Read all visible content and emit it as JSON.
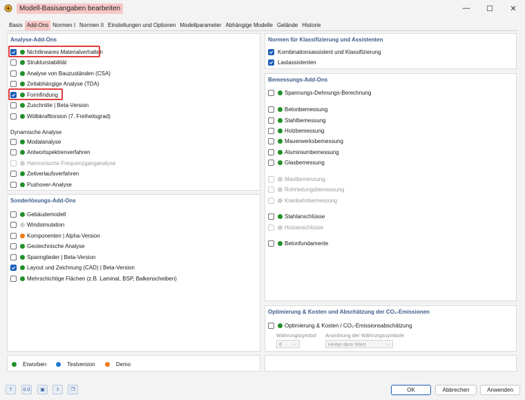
{
  "window": {
    "title": "Modell-Basisangaben bearbeiten"
  },
  "tabs": [
    "Basis",
    "Add-Ons",
    "Normen I",
    "Normen II",
    "Einstellungen und Optionen",
    "Modellparameter",
    "Abhängige Modelle",
    "Gelände",
    "Historie"
  ],
  "analysis": {
    "header": "Analyse-Add-Ons",
    "items": [
      {
        "label": "Nichtlineares Materialverhalten",
        "checked": true,
        "dot": "green"
      },
      {
        "label": "Strukturstabilität",
        "checked": false,
        "dot": "green"
      },
      {
        "label": "Analyse von Bauzuständen (CSA)",
        "checked": false,
        "dot": "green"
      },
      {
        "label": "Zeitabhängige Analyse (TDA)",
        "checked": false,
        "dot": "green"
      },
      {
        "label": "Formfindung",
        "checked": true,
        "dot": "green"
      },
      {
        "label": "Zuschnitte | Beta-Version",
        "checked": false,
        "dot": "green"
      },
      {
        "label": "Wölbkrafttorsion (7. Freiheitsgrad)",
        "checked": false,
        "dot": "green"
      }
    ],
    "dynamic_header": "Dynamische Analyse",
    "dynamic_items": [
      {
        "label": "Modalanalyse",
        "checked": false,
        "dot": "green"
      },
      {
        "label": "Antwortspektrenverfahren",
        "checked": false,
        "dot": "green"
      },
      {
        "label": "Harmonische Frequenzganganalyse",
        "checked": false,
        "dot": "grey",
        "disabled": true
      },
      {
        "label": "Zeitverlaufsverfahren",
        "checked": false,
        "dot": "green"
      },
      {
        "label": "Pushover-Analyse",
        "checked": false,
        "dot": "green"
      }
    ]
  },
  "special": {
    "header": "Sonderlösungs-Add-Ons",
    "items": [
      {
        "label": "Gebäudemodell",
        "checked": false,
        "dot": "green"
      },
      {
        "label": "Windsimulation",
        "checked": false,
        "dot": "grey"
      },
      {
        "label": "Komponenten | Alpha-Version",
        "checked": false,
        "dot": "orange"
      },
      {
        "label": "Geotechnische Analyse",
        "checked": false,
        "dot": "green"
      },
      {
        "label": "Spannglieder | Beta-Version",
        "checked": false,
        "dot": "green"
      },
      {
        "label": "Layout und Zeichnung (CAD) | Beta-Version",
        "checked": true,
        "dot": "green"
      },
      {
        "label": "Mehrschichtige Flächen (z.B. Laminat, BSP, Balkenscheiben)",
        "checked": false,
        "dot": "green"
      }
    ]
  },
  "legend": {
    "erworben": "Erworben",
    "testversion": "Testversion",
    "demo": "Demo"
  },
  "standards": {
    "header": "Normen für Klassifizierung und Assistenten",
    "items": [
      {
        "label": "Kombinationsassistent und Klassifizierung",
        "checked": true
      },
      {
        "label": "Lastassistenten",
        "checked": true
      }
    ]
  },
  "design": {
    "header": "Bemessungs-Add-Ons",
    "items": [
      {
        "label": "Spannungs-Dehnungs-Berechnung",
        "checked": false,
        "dot": "green"
      },
      {
        "label": "Betonbemessung",
        "checked": false,
        "dot": "green"
      },
      {
        "label": "Stahlbemessung",
        "checked": false,
        "dot": "green"
      },
      {
        "label": "Holzbemessung",
        "checked": false,
        "dot": "green"
      },
      {
        "label": "Mauerwerksbemessung",
        "checked": false,
        "dot": "green"
      },
      {
        "label": "Aluminiumbemessung",
        "checked": false,
        "dot": "green"
      },
      {
        "label": "Glasbemessung",
        "checked": false,
        "dot": "green"
      },
      {
        "label": "Mastbemessung",
        "checked": false,
        "dot": "grey",
        "disabled": true
      },
      {
        "label": "Rohrleitungsbemessung",
        "checked": false,
        "dot": "grey",
        "disabled": true
      },
      {
        "label": "Kranbahnbemessung",
        "checked": false,
        "dot": "grey",
        "disabled": true
      },
      {
        "label": "Stahlanschlüsse",
        "checked": false,
        "dot": "green"
      },
      {
        "label": "Holzanschlüsse",
        "checked": false,
        "dot": "grey",
        "disabled": true
      },
      {
        "label": "Betonfundamente",
        "checked": false,
        "dot": "green"
      }
    ]
  },
  "optimization": {
    "header": "Optimierung & Kosten und Abschätzung der CO₂-Emissionen",
    "item": {
      "label": "Optimierung & Kosten / CO₂-Emissionsabschätzung",
      "checked": false,
      "dot": "green"
    },
    "currency_label": "Währungssymbol",
    "currency_value": "€",
    "arrangement_label": "Anordnung der Währungssymbole",
    "arrangement_value": "Hinter dem Wert"
  },
  "buttons": {
    "ok": "OK",
    "cancel": "Abbrechen",
    "apply": "Anwenden"
  },
  "footer_icons": [
    "help-icon",
    "units-icon",
    "display-icon",
    "export-icon",
    "copy-icon"
  ]
}
